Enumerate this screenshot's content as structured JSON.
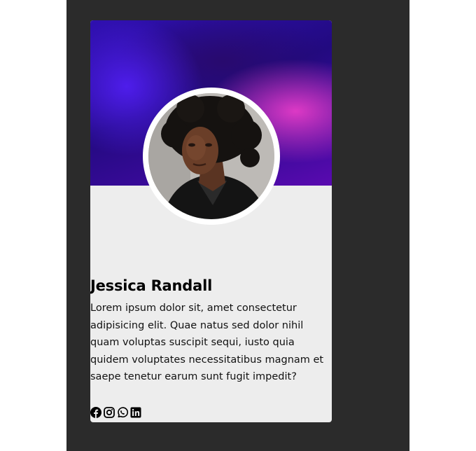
{
  "profile": {
    "name": "Jessica Randall",
    "bio": "Lorem ipsum dolor sit, amet consectetur adipisicing elit. Quae natus sed dolor nihil quam voluptas suscipit sequi, iusto quia quidem voluptates necessitatibus magnam et saepe tenetur earum sunt fugit impedit?"
  },
  "social_icons": [
    "facebook-icon",
    "instagram-icon",
    "whatsapp-icon",
    "linkedin-icon"
  ],
  "colors": {
    "page_background": "#ffffff",
    "panel_background": "#2b2b2b",
    "card_background": "#ededed",
    "banner_purple": "#2f10b0",
    "banner_magenta": "#e63cc8"
  }
}
